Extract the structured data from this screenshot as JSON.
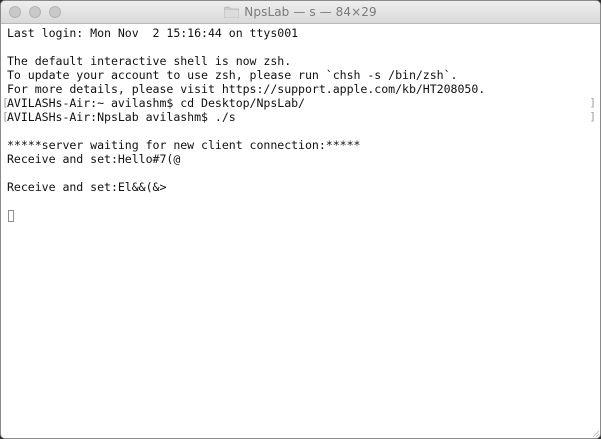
{
  "window": {
    "title": "NpsLab — s — 84×29"
  },
  "terminal": {
    "lines": [
      "Last login: Mon Nov  2 15:16:44 on ttys001",
      "",
      "The default interactive shell is now zsh.",
      "To update your account to use zsh, please run `chsh -s /bin/zsh`.",
      "For more details, please visit https://support.apple.com/kb/HT208050.",
      "AVILASHs-Air:~ avilashm$ cd Desktop/NpsLab/",
      "AVILASHs-Air:NpsLab avilashm$ ./s",
      "",
      "*****server waiting for new client connection:*****",
      "Receive and set:Hello#7(@",
      "",
      "Receive and set:El&&(&>"
    ],
    "mark_char": "["
  },
  "icons": {
    "close": "close-light-icon",
    "minimize": "minimize-light-icon",
    "zoom": "zoom-light-icon",
    "folder": "folder-icon",
    "cursor": "block-cursor-icon"
  },
  "colors": {
    "titlebar": "#e3e3e3",
    "text": "#111111",
    "background": "#ffffff",
    "title_text": "#7a7a7a"
  }
}
